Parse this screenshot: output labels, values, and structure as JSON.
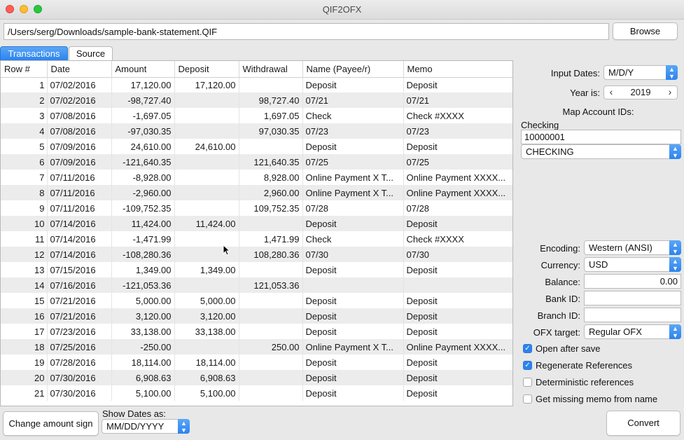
{
  "window": {
    "title": "QIF2OFX"
  },
  "file": {
    "path": "/Users/serg/Downloads/sample-bank-statement.QIF",
    "browse_label": "Browse"
  },
  "tabs": [
    {
      "label": "Transactions",
      "active": true
    },
    {
      "label": "Source",
      "active": false
    }
  ],
  "table": {
    "columns": [
      "Row #",
      "Date",
      "Amount",
      "Deposit",
      "Withdrawal",
      "Name (Payee/r)",
      "Memo"
    ],
    "rows": [
      [
        "1",
        "07/02/2016",
        "17,120.00",
        "17,120.00",
        "",
        "Deposit",
        "Deposit"
      ],
      [
        "2",
        "07/02/2016",
        "-98,727.40",
        "",
        "98,727.40",
        "07/21",
        "07/21"
      ],
      [
        "3",
        "07/08/2016",
        "-1,697.05",
        "",
        "1,697.05",
        "Check",
        "Check #XXXX"
      ],
      [
        "4",
        "07/08/2016",
        "-97,030.35",
        "",
        "97,030.35",
        "07/23",
        "07/23"
      ],
      [
        "5",
        "07/09/2016",
        "24,610.00",
        "24,610.00",
        "",
        "Deposit",
        "Deposit"
      ],
      [
        "6",
        "07/09/2016",
        "-121,640.35",
        "",
        "121,640.35",
        "07/25",
        "07/25"
      ],
      [
        "7",
        "07/11/2016",
        "-8,928.00",
        "",
        "8,928.00",
        "Online Payment X T...",
        "Online Payment XXXX..."
      ],
      [
        "8",
        "07/11/2016",
        "-2,960.00",
        "",
        "2,960.00",
        "Online Payment X T...",
        "Online Payment XXXX..."
      ],
      [
        "9",
        "07/11/2016",
        "-109,752.35",
        "",
        "109,752.35",
        "07/28",
        "07/28"
      ],
      [
        "10",
        "07/14/2016",
        "11,424.00",
        "11,424.00",
        "",
        "Deposit",
        "Deposit"
      ],
      [
        "11",
        "07/14/2016",
        "-1,471.99",
        "",
        "1,471.99",
        "Check",
        "Check #XXXX"
      ],
      [
        "12",
        "07/14/2016",
        "-108,280.36",
        "",
        "108,280.36",
        "07/30",
        "07/30"
      ],
      [
        "13",
        "07/15/2016",
        "1,349.00",
        "1,349.00",
        "",
        "Deposit",
        "Deposit"
      ],
      [
        "14",
        "07/16/2016",
        "-121,053.36",
        "",
        "121,053.36",
        "",
        ""
      ],
      [
        "15",
        "07/21/2016",
        "5,000.00",
        "5,000.00",
        "",
        "Deposit",
        "Deposit"
      ],
      [
        "16",
        "07/21/2016",
        "3,120.00",
        "3,120.00",
        "",
        "Deposit",
        "Deposit"
      ],
      [
        "17",
        "07/23/2016",
        "33,138.00",
        "33,138.00",
        "",
        "Deposit",
        "Deposit"
      ],
      [
        "18",
        "07/25/2016",
        "-250.00",
        "",
        "250.00",
        "Online Payment X T...",
        "Online Payment XXXX..."
      ],
      [
        "19",
        "07/28/2016",
        "18,114.00",
        "18,114.00",
        "",
        "Deposit",
        "Deposit"
      ],
      [
        "20",
        "07/30/2016",
        "6,908.63",
        "6,908.63",
        "",
        "Deposit",
        "Deposit"
      ],
      [
        "21",
        "07/30/2016",
        "5,100.00",
        "5,100.00",
        "",
        "Deposit",
        "Deposit"
      ]
    ]
  },
  "settings": {
    "input_dates_label": "Input Dates:",
    "input_dates_value": "M/D/Y",
    "year_label": "Year is:",
    "year_value": "2019",
    "year_prev": "‹",
    "year_next": "›",
    "map_accounts_label": "Map Account IDs:",
    "account_name": "Checking",
    "account_id": "10000001",
    "account_type": "CHECKING",
    "encoding_label": "Encoding:",
    "encoding_value": "Western (ANSI)",
    "currency_label": "Currency:",
    "currency_value": "USD",
    "balance_label": "Balance:",
    "balance_value": "0.00",
    "bank_id_label": "Bank ID:",
    "bank_id_value": "",
    "branch_id_label": "Branch ID:",
    "branch_id_value": "",
    "ofx_target_label": "OFX target:",
    "ofx_target_value": "Regular OFX",
    "checkboxes": [
      {
        "label": "Open after save",
        "checked": true
      },
      {
        "label": "Regenerate References",
        "checked": true
      },
      {
        "label": "Deterministic references",
        "checked": false
      },
      {
        "label": "Get missing memo from name",
        "checked": false
      }
    ]
  },
  "bottom": {
    "change_sign_label": "Change amount sign",
    "show_dates_label": "Show Dates as:",
    "show_dates_value": "MM/DD/YYYY",
    "convert_label": "Convert"
  },
  "colors": {
    "accent": "#2d83ee",
    "row_alt": "#ececec"
  }
}
